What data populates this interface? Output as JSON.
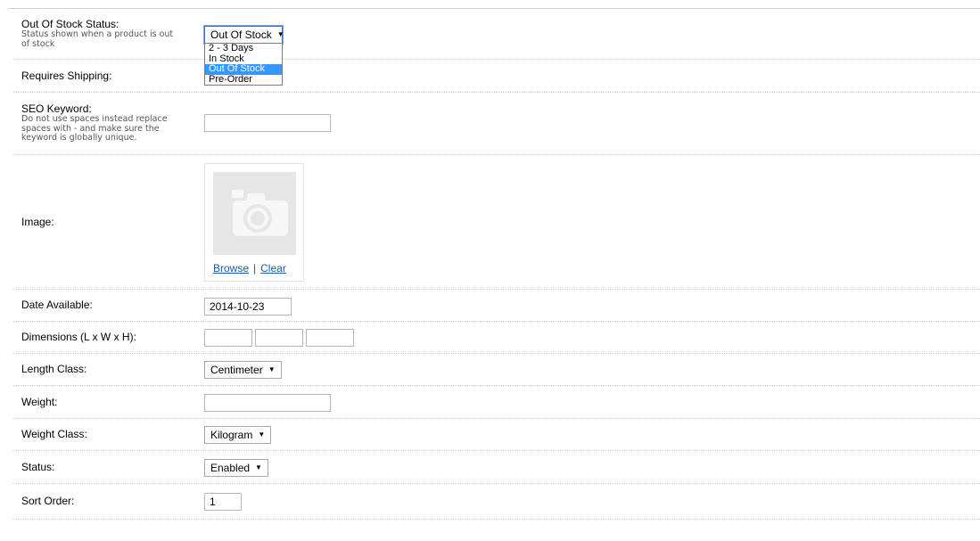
{
  "fields": {
    "out_of_stock": {
      "label": "Out Of Stock Status:",
      "help": "Status shown when a product is out of stock",
      "selected": "Out Of Stock",
      "options": [
        "2 - 3 Days",
        "In Stock",
        "Out Of Stock",
        "Pre-Order"
      ]
    },
    "requires_shipping": {
      "label": "Requires Shipping:"
    },
    "seo_keyword": {
      "label": "SEO Keyword:",
      "help": "Do not use spaces instead replace spaces with - and make sure the keyword is globally unique.",
      "value": ""
    },
    "image": {
      "label": "Image:",
      "browse": "Browse",
      "separator": "|",
      "clear": "Clear",
      "placeholder_icon": "camera-icon"
    },
    "date_available": {
      "label": "Date Available:",
      "value": "2014-10-23"
    },
    "dimensions": {
      "label": "Dimensions (L x W x H):",
      "length": "",
      "width": "",
      "height": ""
    },
    "length_class": {
      "label": "Length Class:",
      "selected": "Centimeter"
    },
    "weight": {
      "label": "Weight:",
      "value": ""
    },
    "weight_class": {
      "label": "Weight Class:",
      "selected": "Kilogram"
    },
    "status": {
      "label": "Status:",
      "selected": "Enabled"
    },
    "sort_order": {
      "label": "Sort Order:",
      "value": "1"
    }
  },
  "colors": {
    "link": "#1f57a8",
    "highlight": "#3399ff",
    "row_border": "#cccccc"
  }
}
